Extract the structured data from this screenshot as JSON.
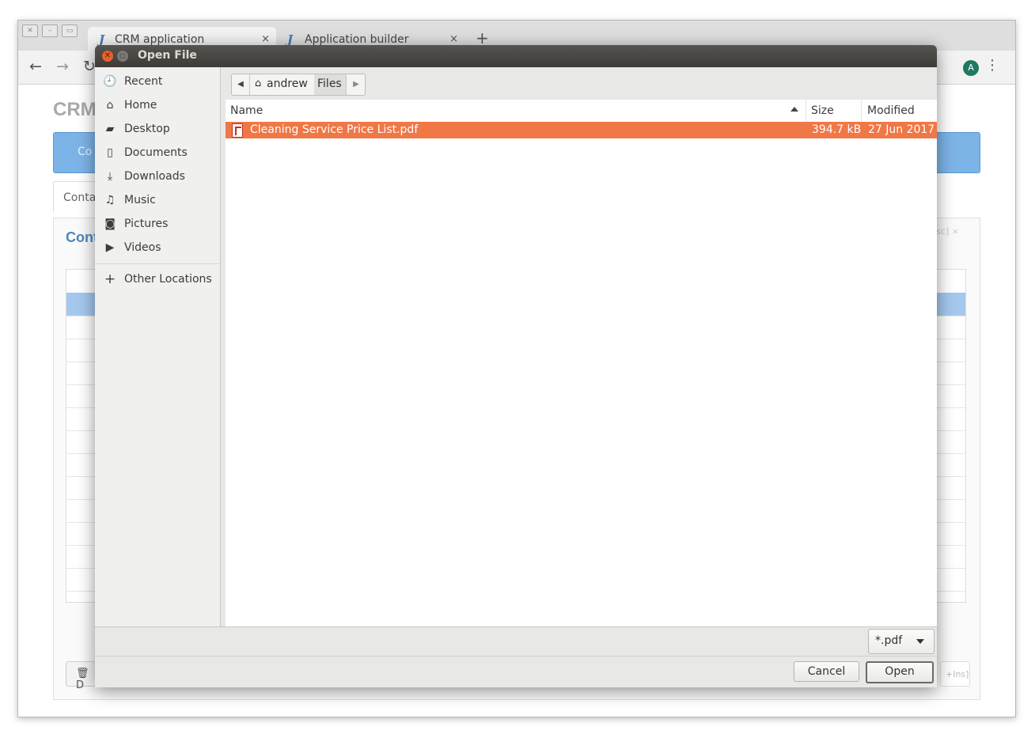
{
  "browser": {
    "tabs": [
      {
        "icon": "J",
        "title": "CRM application",
        "close": "×"
      },
      {
        "icon": "J",
        "title": "Application builder",
        "close": "×"
      }
    ],
    "new_tab": "+",
    "avatar_letter": "A",
    "menu": "⋮"
  },
  "page": {
    "app_title": "CRM",
    "blue_bar_text": "Co",
    "tab_label": "Conta",
    "panel_title": "Cont",
    "panel_hint": "sc] ×",
    "footer_button": "🗑 D",
    "footer_hint": "+Ins]"
  },
  "dialog": {
    "title": "Open File",
    "sidebar": [
      {
        "label": "Recent",
        "icon": "clock-icon"
      },
      {
        "label": "Home",
        "icon": "home-icon"
      },
      {
        "label": "Desktop",
        "icon": "folder-icon"
      },
      {
        "label": "Documents",
        "icon": "document-icon"
      },
      {
        "label": "Downloads",
        "icon": "download-icon"
      },
      {
        "label": "Music",
        "icon": "music-icon"
      },
      {
        "label": "Pictures",
        "icon": "camera-icon"
      },
      {
        "label": "Videos",
        "icon": "video-icon"
      }
    ],
    "other_locations": "Other Locations",
    "path": {
      "home": "andrew",
      "current": "Files"
    },
    "columns": {
      "name": "Name",
      "size": "Size",
      "modified": "Modified"
    },
    "files": [
      {
        "name": "Cleaning Service Price List.pdf",
        "size": "394.7 kB",
        "modified": "27 Jun 2017",
        "selected": true
      }
    ],
    "filter": "*.pdf",
    "cancel_label": "Cancel",
    "open_label": "Open"
  },
  "colors": {
    "selection": "#f07746",
    "titlebar": "#3c3b37",
    "close_button": "#e8602c",
    "crm_blue": "#7db4e8"
  }
}
